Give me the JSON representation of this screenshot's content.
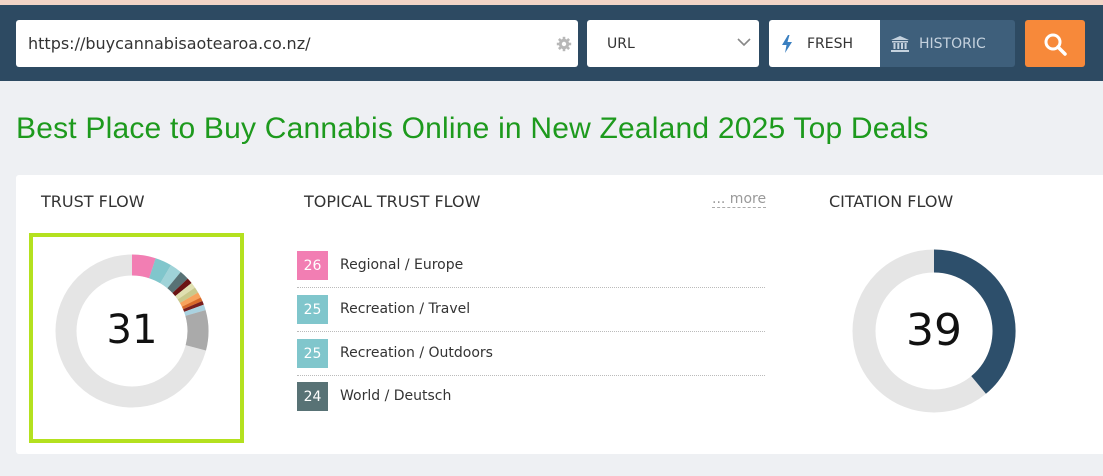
{
  "search": {
    "url_value": "https://buycannabisaotearoa.co.nz/",
    "mode_selected": "URL",
    "fresh_label": "FRESH",
    "historic_label": "HISTORIC",
    "icons": {
      "settings": "gear-icon",
      "dropdown": "chevron-down-icon",
      "fresh": "lightning-icon",
      "historic": "bank-icon",
      "search": "search-icon"
    }
  },
  "page": {
    "title": "Best Place to Buy Cannabis Online in New Zealand 2025 Top Deals"
  },
  "trust_flow": {
    "label": "TRUST FLOW",
    "value": "31"
  },
  "topical": {
    "label": "TOPICAL TRUST FLOW",
    "more_label": "... more",
    "items": [
      {
        "score": "26",
        "label": "Regional / Europe",
        "color": "#f27eb3"
      },
      {
        "score": "25",
        "label": "Recreation / Travel",
        "color": "#80c6cc"
      },
      {
        "score": "25",
        "label": "Recreation / Outdoors",
        "color": "#80c6cc"
      },
      {
        "score": "24",
        "label": "World / Deutsch",
        "color": "#587275"
      }
    ]
  },
  "citation_flow": {
    "label": "CITATION FLOW",
    "value": "39"
  },
  "colors": {
    "header": "#2d4a62",
    "accent_orange": "#f7893a",
    "title_green": "#1d9a1d",
    "highlight_lime": "#b4e11f",
    "citation_arc": "#2d4f6b",
    "ring_track": "#e5e5e5"
  },
  "donut_segments": [
    {
      "color": "#f27eb3",
      "fraction": 0.05
    },
    {
      "color": "#80c6cc",
      "fraction": 0.035
    },
    {
      "color": "#9fd3d8",
      "fraction": 0.025
    },
    {
      "color": "#587275",
      "fraction": 0.02
    },
    {
      "color": "#6b1414",
      "fraction": 0.012
    },
    {
      "color": "#e0e0b0",
      "fraction": 0.012
    },
    {
      "color": "#c9c98c",
      "fraction": 0.012
    },
    {
      "color": "#f7a35c",
      "fraction": 0.012
    },
    {
      "color": "#d96a2a",
      "fraction": 0.008
    },
    {
      "color": "#7a1e1e",
      "fraction": 0.008
    },
    {
      "color": "#aad2e0",
      "fraction": 0.012
    },
    {
      "color": "#aaaaaa",
      "fraction": 0.085
    }
  ],
  "citation_fraction": 0.39
}
